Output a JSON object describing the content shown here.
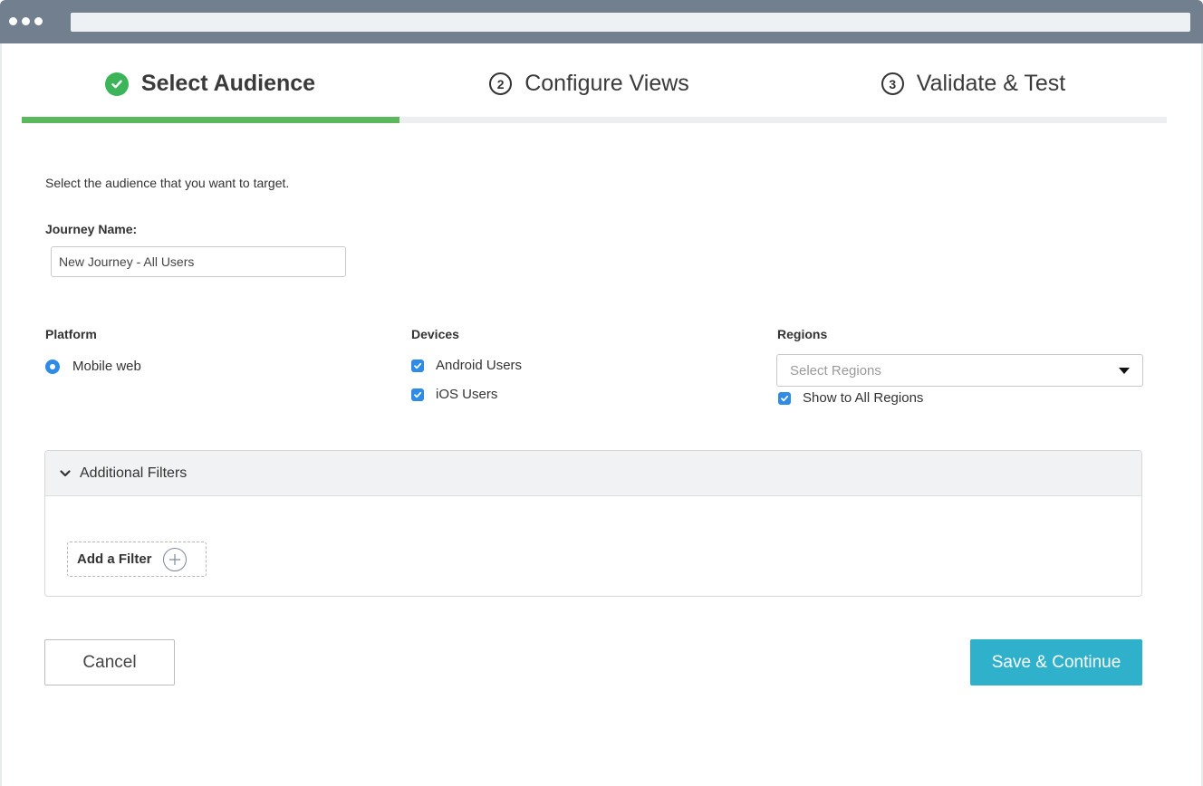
{
  "steps": [
    {
      "label": "Select Audience",
      "number": "",
      "status": "complete"
    },
    {
      "label": "Configure Views",
      "number": "2",
      "status": "pending"
    },
    {
      "label": "Validate & Test",
      "number": "3",
      "status": "pending"
    }
  ],
  "step_progress": 0.33,
  "intro": "Select the audience that you want to target.",
  "journey": {
    "label": "Journey Name:",
    "value": "New Journey - All Users"
  },
  "platform": {
    "label": "Platform",
    "options": [
      {
        "label": "Mobile web",
        "selected": true
      }
    ]
  },
  "devices": {
    "label": "Devices",
    "options": [
      {
        "label": "Android Users",
        "checked": true
      },
      {
        "label": "iOS Users",
        "checked": true
      }
    ]
  },
  "regions": {
    "label": "Regions",
    "placeholder": "Select Regions",
    "show_all_label": "Show to All Regions",
    "show_all_checked": true
  },
  "filters": {
    "title": "Additional Filters",
    "add_label": "Add a Filter"
  },
  "actions": {
    "cancel": "Cancel",
    "save": "Save & Continue"
  },
  "colors": {
    "chrome": "#717f8f",
    "success": "#3cb55a",
    "progress": "#5cb85c",
    "checkbox": "#2f8be6",
    "primary": "#2fb1cc"
  }
}
